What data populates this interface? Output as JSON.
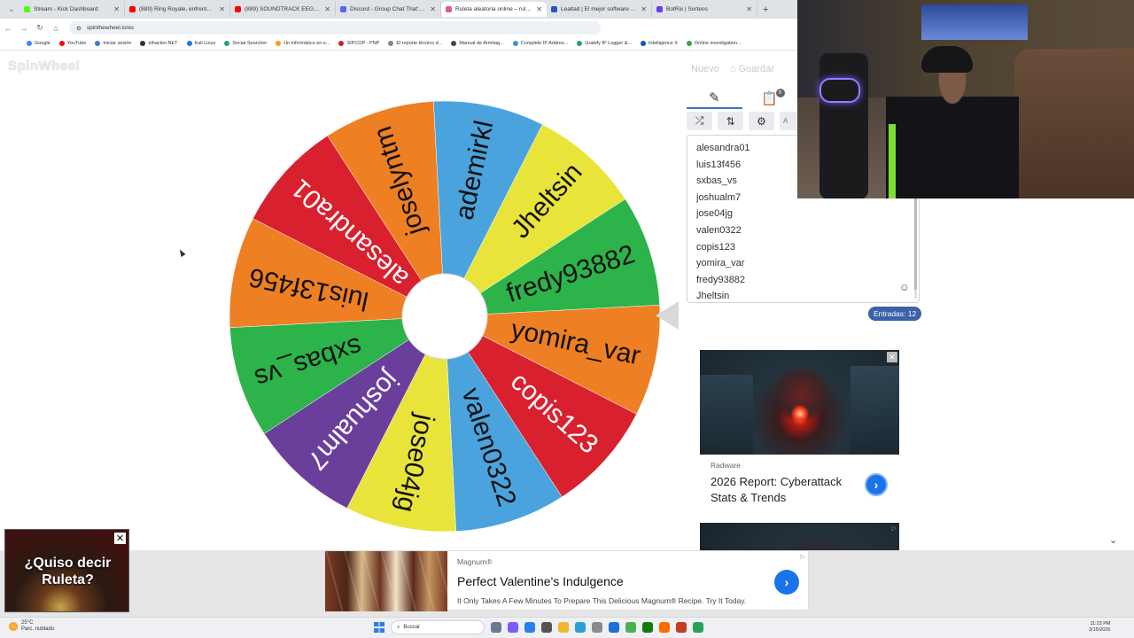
{
  "browser": {
    "tabs": [
      {
        "label": "Stream - Kick Dashboard",
        "color": "#53fc18",
        "active": false
      },
      {
        "label": "(889) Ring Royale, enfrentamie",
        "color": "#ff0000",
        "active": false
      },
      {
        "label": "(889) SOUNDTRACK EEG | GAN",
        "color": "#ff0000",
        "active": false
      },
      {
        "label": "Discord - Group Chat That's All",
        "color": "#5865f2",
        "active": false
      },
      {
        "label": "Ruleta aleatoria online – ruleta",
        "color": "#e05a9a",
        "active": true
      },
      {
        "label": "Lealtad | El mejor software para",
        "color": "#2255cc",
        "active": false
      },
      {
        "label": "BotRix | Sorteos",
        "color": "#6a3de8",
        "active": false
      }
    ],
    "url": "spinthewheel.io/es",
    "bookmarks": [
      {
        "label": "Google",
        "color": "#4285f4"
      },
      {
        "label": "YouTube",
        "color": "#ff0000"
      },
      {
        "label": "Iniciar sesión",
        "color": "#3a7bd5"
      },
      {
        "label": "elhacker.NET",
        "color": "#333333"
      },
      {
        "label": "Kali Linux",
        "color": "#2277dd"
      },
      {
        "label": "Social Searcher",
        "color": "#2ba36b"
      },
      {
        "label": "Un informático en e...",
        "color": "#f0a020"
      },
      {
        "label": "SIPCOP - PNP",
        "color": "#cc2222"
      },
      {
        "label": "El reporte técnico d...",
        "color": "#888888"
      },
      {
        "label": "Manual de Armitag...",
        "color": "#444444"
      },
      {
        "label": "Complete IP Addres...",
        "color": "#3399cc"
      },
      {
        "label": "Grabify IP Logger &...",
        "color": "#2ba36b"
      },
      {
        "label": "Intelligence X",
        "color": "#1155aa"
      },
      {
        "label": "Online investigation...",
        "color": "#33aa44"
      }
    ]
  },
  "app": {
    "logo": "SpinWheel",
    "new_label": "Nuevo",
    "save_label": "Guardar",
    "results_badge": "0",
    "entries_count_label": "Entradas: 12",
    "more_label": "A",
    "entries_list": [
      "alesandra01",
      "luis13f456",
      "sxbas_vs",
      "joshualm7",
      "jose04jg",
      "valen0322",
      "copis123",
      "yomira_var",
      "fredy93882",
      "Jheltsin"
    ]
  },
  "wheel": {
    "slices": [
      {
        "label": "ademirkl",
        "color": "#4aa3dc"
      },
      {
        "label": "Jheltsin",
        "color": "#e8e43a"
      },
      {
        "label": "fredy93882",
        "color": "#2cb34a"
      },
      {
        "label": "yomira_var",
        "color": "#ee7f22"
      },
      {
        "label": "copis123",
        "color": "#d9202e"
      },
      {
        "label": "valen0322",
        "color": "#4aa3dc"
      },
      {
        "label": "jose04jg",
        "color": "#e8e43a"
      },
      {
        "label": "joshualm7",
        "color": "#6a3f9c"
      },
      {
        "label": "sxbas_vs",
        "color": "#2cb34a"
      },
      {
        "label": "luis13f456",
        "color": "#ee7f22"
      },
      {
        "label": "alesandra01",
        "color": "#d9202e"
      },
      {
        "label": "joselyntm",
        "color": "#ee7f22"
      }
    ],
    "start_angle_deg": -93,
    "slice_angle_deg": 30
  },
  "ads": {
    "side": {
      "source": "Radware",
      "title": "2026 Report: Cyberattack Stats & Trends"
    },
    "bottom": {
      "source": "Magnum®",
      "title": "Perfect Valentine's Indulgence",
      "subtitle": "It Only Takes A Few Minutes To Prepare This Delicious Magnum® Recipe. Try It Today."
    },
    "corner": {
      "text": "¿Quiso decir Ruleta?"
    }
  },
  "taskbar": {
    "temp": "25°C",
    "weather": "Parc. nublado",
    "search_placeholder": "Buscar",
    "time": "11:23 PM",
    "date": "3/15/2026",
    "apps": [
      "#6b7a8c",
      "#7a5cff",
      "#2a7fe8",
      "#555555",
      "#f2b631",
      "#2aa0d8",
      "#8a8a8a",
      "#1c6fd8",
      "#4caf50",
      "#107c10",
      "#ff6a00",
      "#c23b22",
      "#2aa05a"
    ]
  }
}
